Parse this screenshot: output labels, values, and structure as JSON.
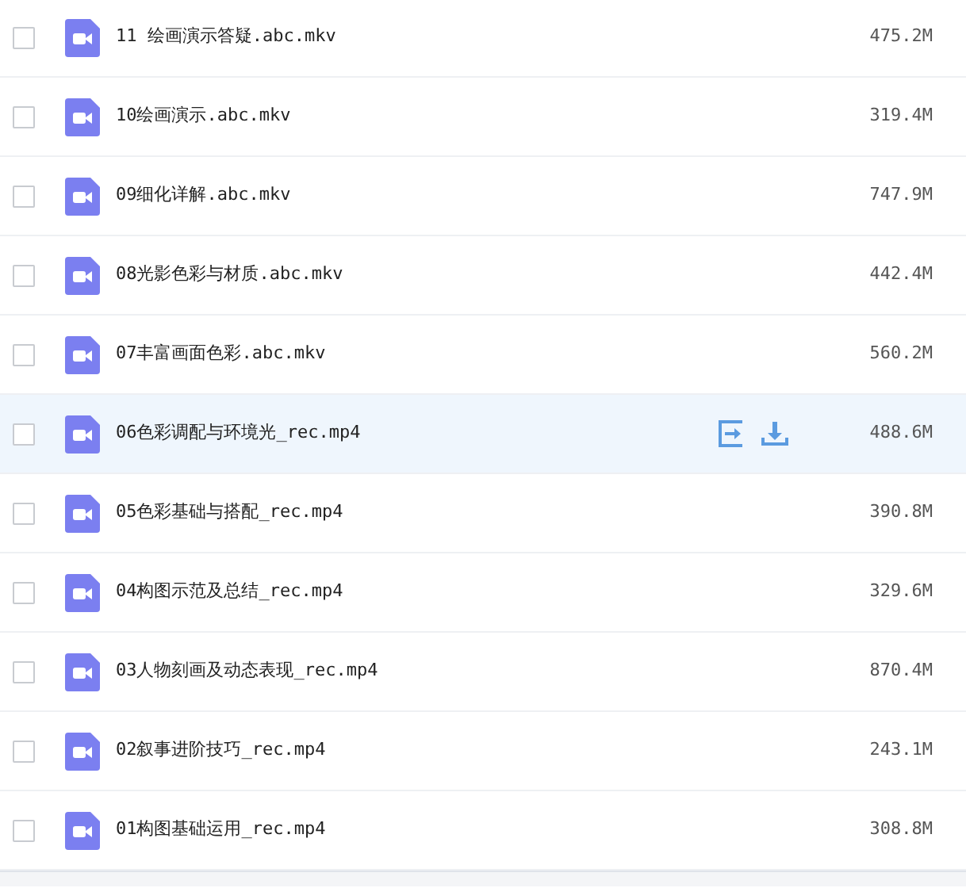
{
  "files": [
    {
      "name": "11 绘画演示答疑.abc.mkv",
      "size": "475.2M",
      "checked": false,
      "hovered": false
    },
    {
      "name": "10绘画演示.abc.mkv",
      "size": "319.4M",
      "checked": false,
      "hovered": false
    },
    {
      "name": "09细化详解.abc.mkv",
      "size": "747.9M",
      "checked": false,
      "hovered": false
    },
    {
      "name": "08光影色彩与材质.abc.mkv",
      "size": "442.4M",
      "checked": false,
      "hovered": false
    },
    {
      "name": "07丰富画面色彩.abc.mkv",
      "size": "560.2M",
      "checked": false,
      "hovered": false
    },
    {
      "name": "06色彩调配与环境光_rec.mp4",
      "size": "488.6M",
      "checked": false,
      "hovered": true
    },
    {
      "name": "05色彩基础与搭配_rec.mp4",
      "size": "390.8M",
      "checked": false,
      "hovered": false
    },
    {
      "name": "04构图示范及总结_rec.mp4",
      "size": "329.6M",
      "checked": false,
      "hovered": false
    },
    {
      "name": "03人物刻画及动态表现_rec.mp4",
      "size": "870.4M",
      "checked": false,
      "hovered": false
    },
    {
      "name": "02叙事进阶技巧_rec.mp4",
      "size": "243.1M",
      "checked": false,
      "hovered": false
    },
    {
      "name": "01构图基础运用_rec.mp4",
      "size": "308.8M",
      "checked": false,
      "hovered": false
    }
  ]
}
